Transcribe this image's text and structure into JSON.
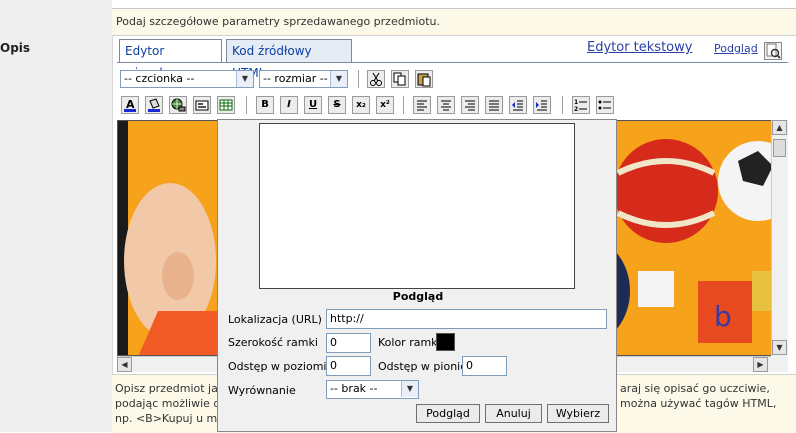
{
  "hint": "Podaj szczegółowe parametry sprzedawanego przedmiotu.",
  "field_label": "Opis",
  "tabs": {
    "visual": "Edytor wizualny",
    "html": "Kod źródłowy HTML",
    "text_editor": "Edytor tekstowy",
    "preview": "Podgląd"
  },
  "toolbar": {
    "font_select": "-- czcionka --",
    "size_select": "-- rozmiar --",
    "bold": "B",
    "italic": "I",
    "underline": "U",
    "strike": "S",
    "subscript": "x₂",
    "superscript": "x²"
  },
  "dialog": {
    "preview_caption": "Podgląd",
    "url_label": "Lokalizacja (URL)",
    "url_value": "http://",
    "border_width_label": "Szerokość ramki",
    "border_width_value": "0",
    "border_color_label": "Kolor ramki",
    "border_color": "#000000",
    "hspace_label": "Odstęp w poziomie",
    "hspace_value": "0",
    "vspace_label": "Odstęp w pionie",
    "vspace_value": "0",
    "align_label": "Wyrównanie",
    "align_value": "-- brak --",
    "btn_preview": "Podgląd",
    "btn_cancel": "Anuluj",
    "btn_choose": "Wybierz"
  },
  "footer": {
    "line1_left": "Opisz przedmiot ja",
    "line1_right": "araj się opisać go uczciwie,",
    "line2_left": "podając możliwie d",
    "line2_right": "można używać tagów HTML,",
    "line3_left": "np. <B>Kupuj u mn"
  },
  "colors": {
    "accent": "#0b3fa6",
    "hint_bg": "#fdf9e8",
    "editor_bg": "#f6a21a"
  }
}
